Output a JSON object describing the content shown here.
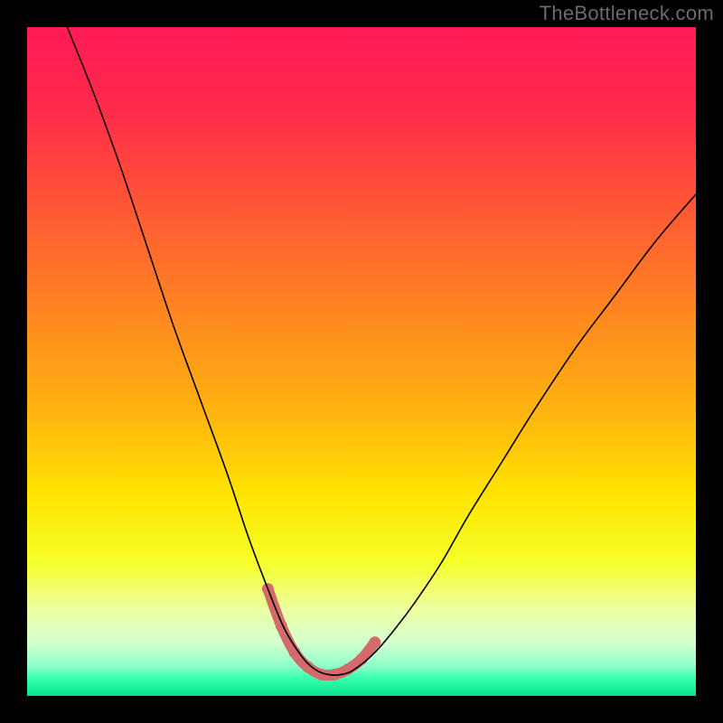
{
  "watermark": "TheBottleneck.com",
  "colors": {
    "page_bg": "#000000",
    "watermark_text": "#6b6b6b",
    "curve": "#000000",
    "trough_highlight": "#d46a6a",
    "gradient_stops": [
      {
        "offset": "0%",
        "color": "#ff1a55"
      },
      {
        "offset": "12%",
        "color": "#ff2a4a"
      },
      {
        "offset": "28%",
        "color": "#ff5a33"
      },
      {
        "offset": "44%",
        "color": "#ff8a1f"
      },
      {
        "offset": "58%",
        "color": "#ffb50f"
      },
      {
        "offset": "70%",
        "color": "#ffe400"
      },
      {
        "offset": "80%",
        "color": "#f7ff2a"
      },
      {
        "offset": "87%",
        "color": "#ecffa0"
      },
      {
        "offset": "92%",
        "color": "#d6ffcf"
      },
      {
        "offset": "95.5%",
        "color": "#8dffc8"
      },
      {
        "offset": "97.5%",
        "color": "#33ffac"
      },
      {
        "offset": "100%",
        "color": "#06e08e"
      }
    ]
  },
  "chart_data": {
    "type": "line",
    "title": "",
    "xlabel": "",
    "ylabel": "",
    "xlim": [
      0,
      100
    ],
    "ylim": [
      0,
      100
    ],
    "grid": false,
    "legend": false,
    "annotations": [
      "TheBottleneck.com"
    ],
    "series": [
      {
        "name": "bottleneck-curve",
        "x": [
          6,
          10,
          14,
          18,
          22,
          26,
          30,
          33,
          36,
          38.5,
          41,
          43,
          45,
          47,
          49,
          52,
          55,
          58,
          62,
          66,
          71,
          76,
          82,
          88,
          94,
          100
        ],
        "y": [
          100,
          90,
          79,
          67,
          55,
          44,
          33,
          24,
          16,
          10,
          6,
          4,
          3.2,
          3.2,
          4,
          6.5,
          10,
          14,
          20,
          27,
          35,
          43,
          52,
          60,
          68,
          75
        ]
      },
      {
        "name": "optimal-trough-highlight",
        "x": [
          36,
          38,
          40,
          42,
          44,
          46,
          48,
          50,
          52
        ],
        "y": [
          16,
          10.5,
          6.5,
          4.3,
          3.2,
          3.2,
          4,
          5.5,
          8
        ]
      }
    ]
  }
}
